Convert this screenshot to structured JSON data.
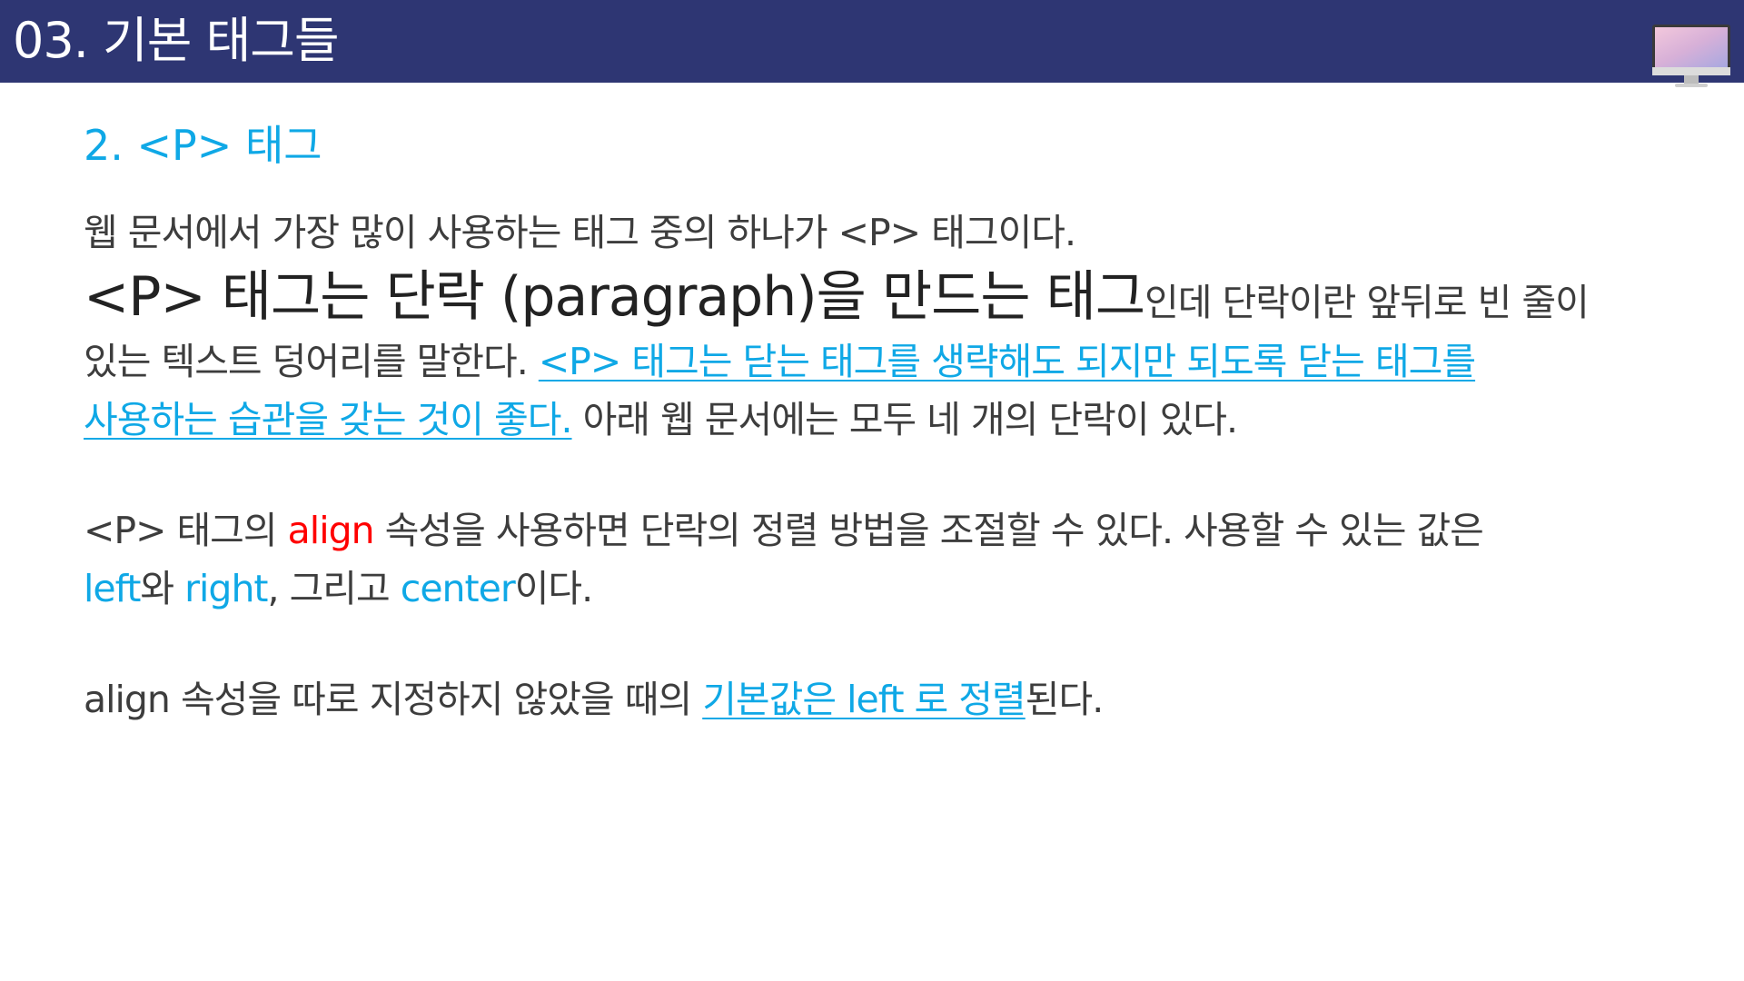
{
  "header": {
    "title": "03. 기본 태그들",
    "icon": "monitor-icon"
  },
  "section": {
    "title": "2. <P> 태그"
  },
  "paragraph1": {
    "line1": "웹 문서에서 가장 많이 사용하는 태그 중의 하나가 <P> 태그이다.",
    "line2_big": "<P> 태그는 단락 (paragraph)을 만드는 태그",
    "line2_rest": "인데 단락이란 앞뒤로 빈 줄이",
    "line3_plain": "있는 텍스트 덩어리를 말한다. ",
    "line3_link": "<P> 태그는 닫는 태그를 생략해도 되지만 되도록 닫는 태그를",
    "line4_link": "사용하는 습관을 갖는 것이 좋다.",
    "line4_rest": " 아래 웹 문서에는 모두 네 개의 단락이 있다."
  },
  "paragraph2": {
    "prefix": "<P> 태그의 ",
    "align": "align",
    "middle": " 속성을 사용하면 단락의 정렬 방법을 조절할 수 있다. 사용할 수 있는 값은",
    "left": "left",
    "wa": "와 ",
    "right": "right",
    "comma": ", 그리고 ",
    "center": "center",
    "end": "이다."
  },
  "paragraph3": {
    "prefix": "align 속성을 따로 지정하지 않았을 때의 ",
    "link": "기본값은 left 로 정렬",
    "suffix": "된다."
  },
  "colors": {
    "header_bg": "#2e3673",
    "accent_blue": "#0fa8e6",
    "accent_red": "#ff0000",
    "body_text": "#3d3d3d"
  }
}
